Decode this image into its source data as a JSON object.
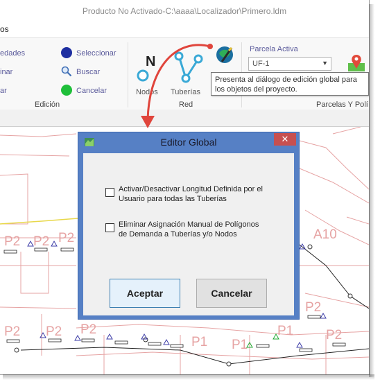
{
  "app": {
    "window_title": "Producto No Activado-C:\\aaaa\\Localizador\\Primero.ldm",
    "menu_fragment": "os"
  },
  "ribbon": {
    "edicion": {
      "label": "Edición",
      "left_fragments": [
        "edades",
        "inar",
        "ar"
      ],
      "actions": [
        "Seleccionar",
        "Buscar",
        "Cancelar"
      ]
    },
    "red": {
      "label": "Red",
      "tools": [
        "Nodos",
        "Tuberías"
      ]
    },
    "parcelas": {
      "label": "Parcelas Y Polí",
      "field_label": "Parcela Activa",
      "field_value": "UF-1"
    }
  },
  "tooltip": {
    "line1": "Presenta al diálogo de edición global para",
    "line2": "los objetos del proyecto."
  },
  "dialog": {
    "title": "Editor Global",
    "close_glyph": "✕",
    "option1_line1": "Activar/Desactivar Longitud Definida por el",
    "option1_line2": "Usuario para todas las Tuberías",
    "option1_checked": false,
    "option2_line1": "Eliminar Asignación Manual de Polígonos",
    "option2_line2": "de Demanda a Tuberías y/o Nodos",
    "option2_checked": false,
    "ok_label": "Aceptar",
    "cancel_label": "Cancelar"
  },
  "map": {
    "labels": [
      "P2",
      "P2",
      "P2",
      "A10",
      "P2",
      "P2",
      "P2",
      "P2",
      "P1",
      "P1",
      "P1",
      "P2"
    ]
  },
  "colors": {
    "dialog_frame": "#5680c5",
    "close_button": "#c75050",
    "arrow": "#e0453c",
    "parcel_lines": "#e6a3a3",
    "node_marker": "#3e3ea8",
    "green_marker": "#22aa33"
  }
}
